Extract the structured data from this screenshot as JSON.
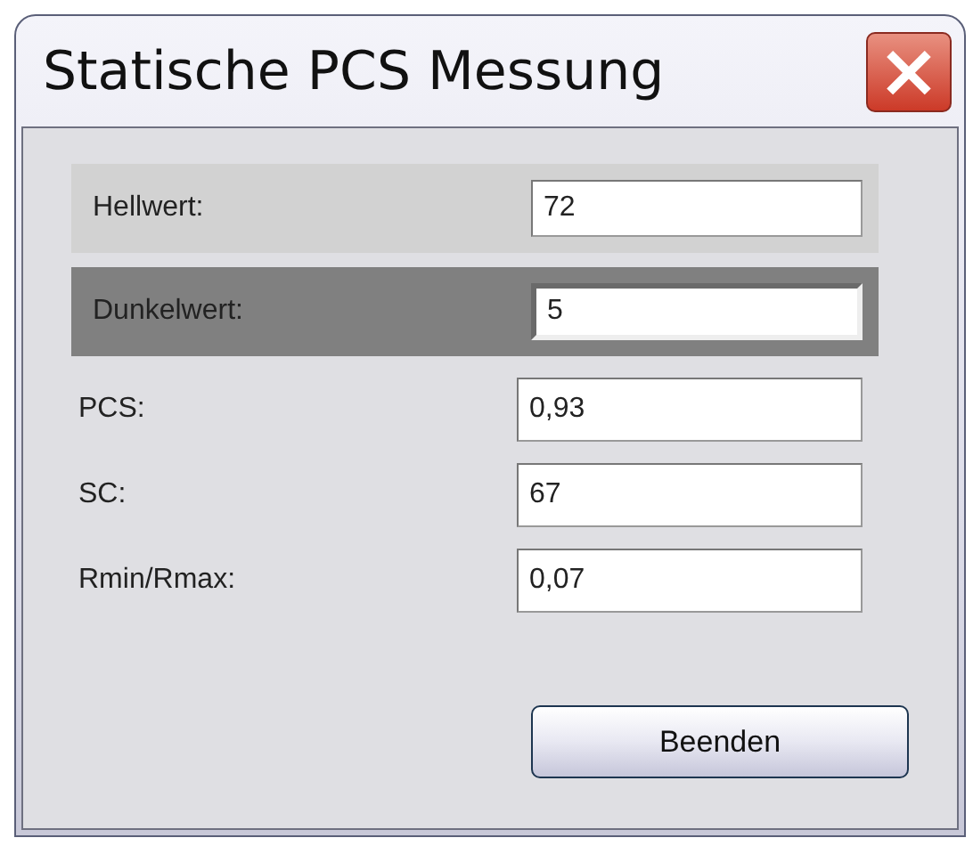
{
  "window": {
    "title": "Statische PCS Messung",
    "close": "×"
  },
  "fields": [
    {
      "label": "Hellwert:",
      "value": "72",
      "kind": "light",
      "focused": false
    },
    {
      "label": "Dunkelwert:",
      "value": "5",
      "kind": "dark",
      "focused": true
    },
    {
      "label": "PCS:",
      "value": "0,93",
      "kind": "plain",
      "focused": false
    },
    {
      "label": "SC:",
      "value": "67",
      "kind": "plain",
      "focused": false
    },
    {
      "label": "Rmin/Rmax:",
      "value": "0,07",
      "kind": "plain",
      "focused": false
    }
  ],
  "buttons": [
    "Beenden"
  ]
}
